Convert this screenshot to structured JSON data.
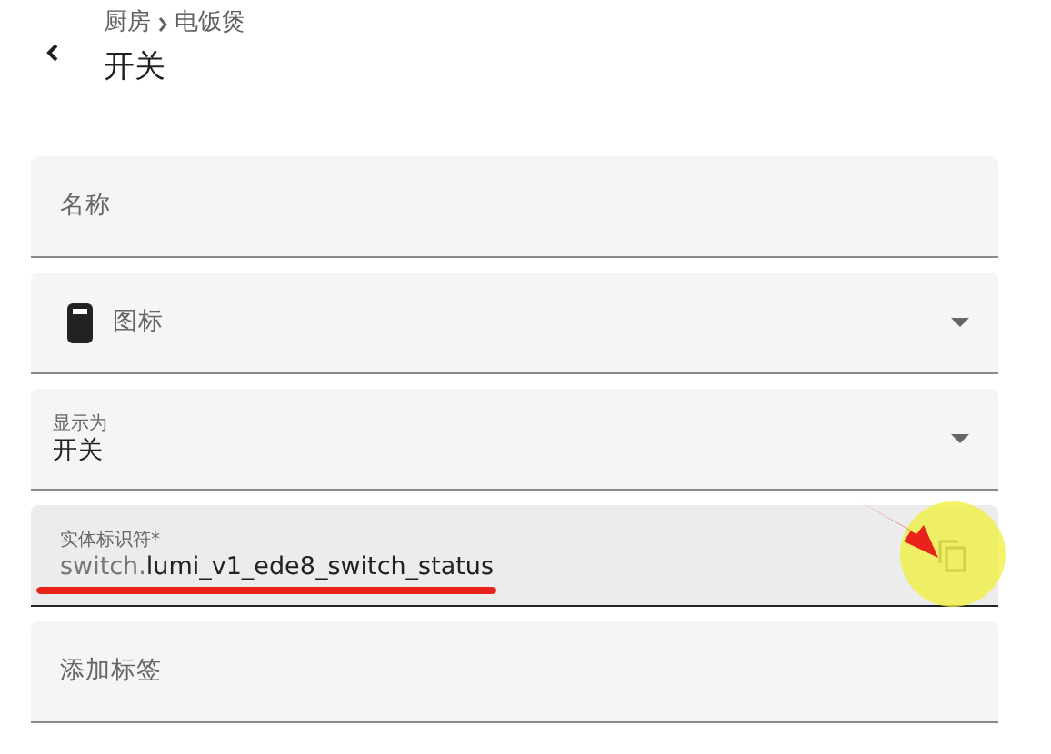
{
  "header": {
    "breadcrumb": [
      "厨房",
      "电饭煲"
    ],
    "title": "开关"
  },
  "fields": [
    {
      "kind": "text",
      "label": "名称"
    },
    {
      "kind": "icon-select",
      "label": "图标"
    },
    {
      "kind": "select",
      "label": "显示为",
      "value": "开关"
    },
    {
      "kind": "entity-id",
      "label": "实体标识符*",
      "value_prefix": "switch.",
      "value": "lumi_v1_ede8_switch_status",
      "focused": true
    },
    {
      "kind": "text",
      "label": "添加标签"
    }
  ]
}
